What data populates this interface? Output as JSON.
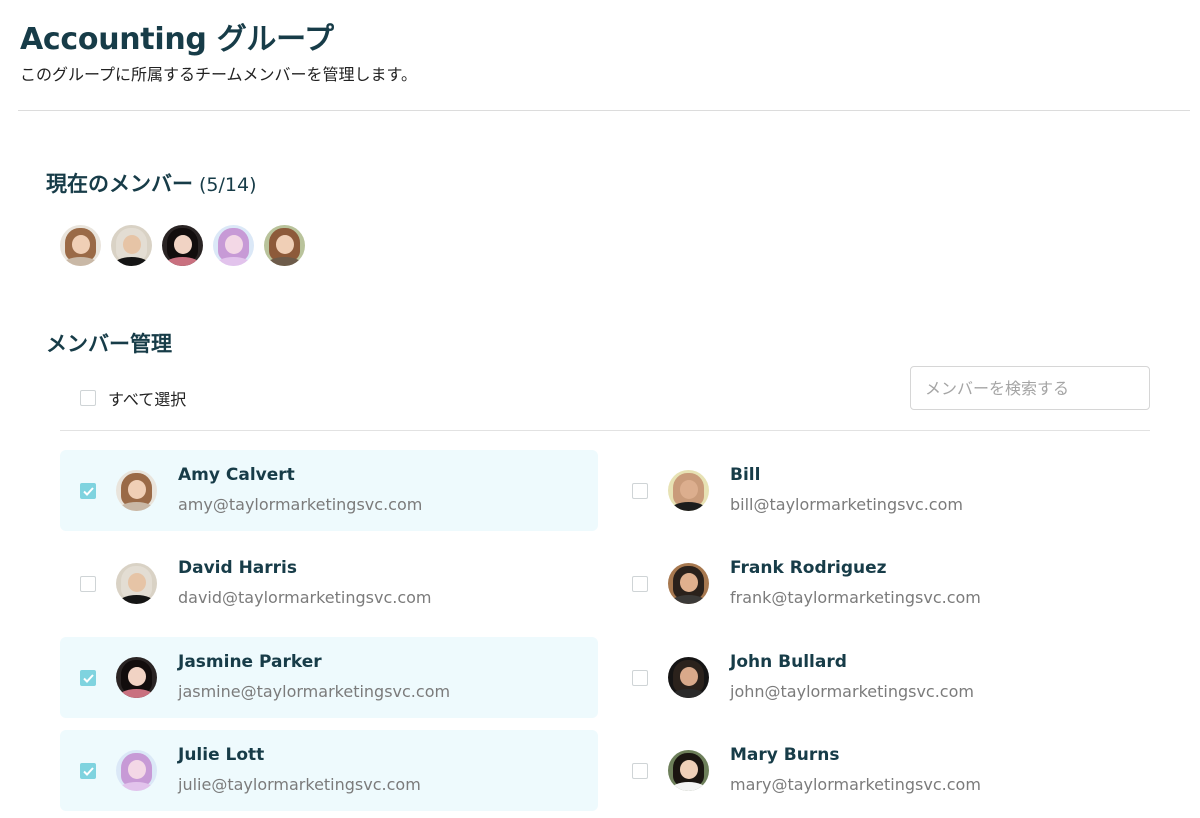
{
  "header": {
    "title": "Accounting グループ",
    "subtitle": "このグループに所属するチームメンバーを管理します。"
  },
  "current_members": {
    "heading": "現在のメンバー",
    "count": "(5/14)",
    "avatars": [
      {
        "name": "Amy Calvert",
        "bg": "#e9e4dc",
        "hair": "#9a6a47",
        "face": "#f0cfb6",
        "shirt": "#c9b8a6"
      },
      {
        "name": "David Harris",
        "bg": "#d9d2c5",
        "hair": "#e3ddd3",
        "face": "#e6c4a6",
        "shirt": "#151515"
      },
      {
        "name": "Jasmine Parker",
        "bg": "#2a2424",
        "hair": "#120d0d",
        "face": "#f1d3c4",
        "shirt": "#c9707f"
      },
      {
        "name": "Julie Lott",
        "bg": "#dbe8f7",
        "hair": "#c79ad6",
        "face": "#f3d8e6",
        "shirt": "#e2c3ec"
      },
      {
        "name": "Amy Calvert",
        "bg": "#b9c39b",
        "hair": "#8d5a3a",
        "face": "#f0cfb6",
        "shirt": "#6d5b4a"
      }
    ]
  },
  "management": {
    "heading": "メンバー管理",
    "select_all_label": "すべて選択",
    "search_placeholder": "メンバーを検索する"
  },
  "members": [
    {
      "name": "Amy Calvert",
      "email": "amy@taylormarketingsvc.com",
      "checked": true,
      "avatar": {
        "bg": "#e9e4dc",
        "hair": "#9a6a47",
        "face": "#f0cfb6",
        "shirt": "#c9b8a6"
      }
    },
    {
      "name": "Bill",
      "email": "bill@taylormarketingsvc.com",
      "checked": false,
      "avatar": {
        "bg": "#e7e2b4",
        "hair": "#c99b7a",
        "face": "#dcae8e",
        "shirt": "#1c1c1c"
      }
    },
    {
      "name": "David Harris",
      "email": "david@taylormarketingsvc.com",
      "checked": false,
      "avatar": {
        "bg": "#d9d2c5",
        "hair": "#e3ddd3",
        "face": "#e6c4a6",
        "shirt": "#151515"
      }
    },
    {
      "name": "Frank Rodriguez",
      "email": "frank@taylormarketingsvc.com",
      "checked": false,
      "avatar": {
        "bg": "#a7784f",
        "hair": "#2a211b",
        "face": "#e0b08e",
        "shirt": "#3b3a38"
      }
    },
    {
      "name": "Jasmine Parker",
      "email": "jasmine@taylormarketingsvc.com",
      "checked": true,
      "avatar": {
        "bg": "#2a2424",
        "hair": "#120d0d",
        "face": "#f1d3c4",
        "shirt": "#c9707f"
      }
    },
    {
      "name": "John Bullard",
      "email": "john@taylormarketingsvc.com",
      "checked": false,
      "avatar": {
        "bg": "#151414",
        "hair": "#2b221c",
        "face": "#d9a98a",
        "shirt": "#2a2a2a"
      }
    },
    {
      "name": "Julie Lott",
      "email": "julie@taylormarketingsvc.com",
      "checked": true,
      "avatar": {
        "bg": "#dbe8f7",
        "hair": "#c79ad6",
        "face": "#f3d8e6",
        "shirt": "#e2c3ec"
      }
    },
    {
      "name": "Mary Burns",
      "email": "mary@taylormarketingsvc.com",
      "checked": false,
      "avatar": {
        "bg": "#6d7f5a",
        "hair": "#1a1511",
        "face": "#efd0b8",
        "shirt": "#f4f4f4"
      }
    }
  ],
  "colors": {
    "heading": "#173c48",
    "checkbox_checked": "#7fd3df",
    "selected_row_bg": "#eefafd",
    "email_text": "#7b7b7b"
  }
}
